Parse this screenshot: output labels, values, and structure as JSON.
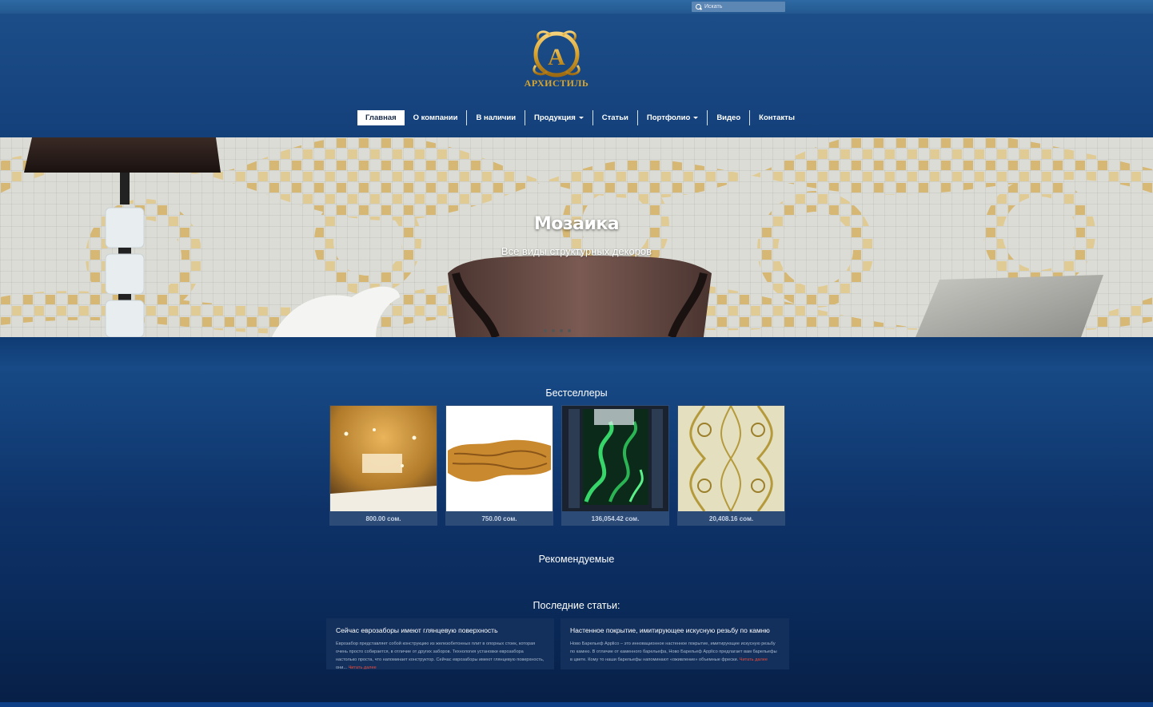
{
  "search": {
    "placeholder": "Искать",
    "icon": "search-icon"
  },
  "logo": {
    "brand": "АРХИСТИЛЬ",
    "letter": "А"
  },
  "nav": {
    "items": [
      {
        "label": "Главная",
        "active": true
      },
      {
        "label": "О компании"
      },
      {
        "label": "В наличии"
      },
      {
        "label": "Продукция",
        "dropdown": true
      },
      {
        "label": "Статьи"
      },
      {
        "label": "Портфолио",
        "dropdown": true
      },
      {
        "label": "Видео"
      },
      {
        "label": "Контакты"
      }
    ]
  },
  "hero": {
    "title": "Мозаика",
    "subtitle": "Все виды структурных декоров",
    "slides": 4,
    "active_slide": 1
  },
  "bestsellers": {
    "heading": "Бестселлеры",
    "products": [
      {
        "price": "800.00 сом."
      },
      {
        "price": "750.00 сом."
      },
      {
        "price": "136,054.42 сом."
      },
      {
        "price": "20,408.16 сом."
      }
    ]
  },
  "recommended": {
    "heading": "Рекомендуемые"
  },
  "articles": {
    "heading": "Последние статьи:",
    "items": [
      {
        "title": "Сейчас еврозаборы имеют глянцевую поверхность",
        "text": "Еврозабор представляет собой конструкцию из железобетонных плит в опорных стоек, которая очень просто собирается, в отличие от других заборов. Технология установки еврозабора настолько проста, что напоминает конструктор. Сейчас еврозаборы имеют глянцевую поверхность, они...",
        "more": "Читать далее"
      },
      {
        "title": "Настенное покрытие, имитирующее искусную резьбу по камню",
        "text": "Ново Барельеф Applico – это инновационное настенное покрытие, имитирующее искусную резьбу по камню. В отличие от каменного барельефа, Ново Барельеф Applico предлагает вам барельефы в цвете. Кому то наши барельефы напоминают «оживление» объемные фрески.",
        "more": "Читать далее"
      }
    ]
  },
  "colors": {
    "accent_gold": "#d8a52f",
    "link_red": "#e84c3d",
    "background_blue": "#14407a"
  }
}
